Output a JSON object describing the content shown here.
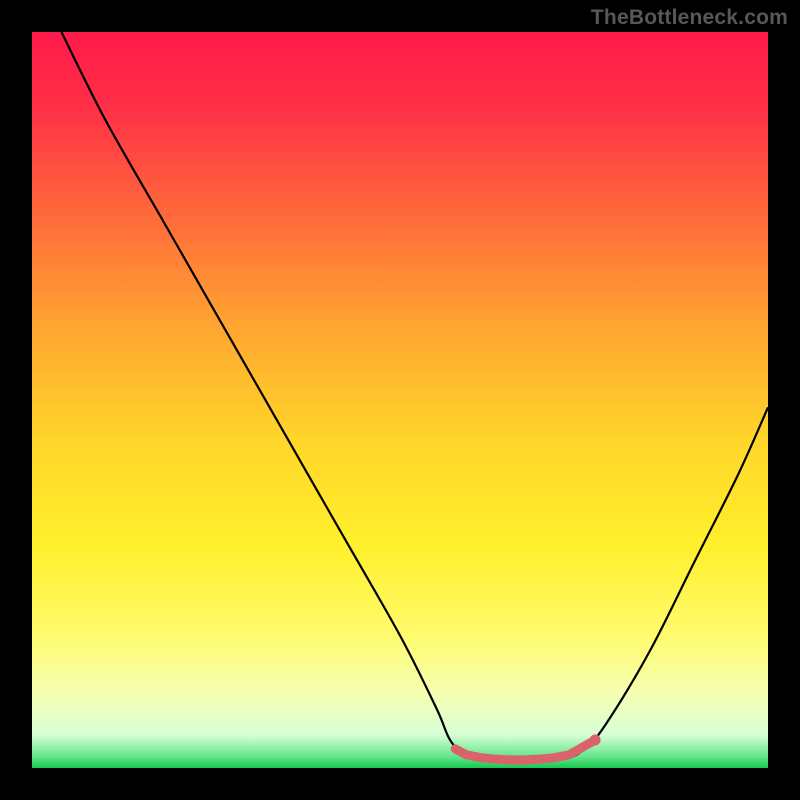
{
  "watermark": "TheBottleneck.com",
  "chart_data": {
    "type": "line",
    "title": "",
    "xlabel": "",
    "ylabel": "",
    "xlim": [
      0,
      100
    ],
    "ylim": [
      0,
      100
    ],
    "gradient_stops": [
      {
        "offset": 0,
        "color": "#ff1a4b"
      },
      {
        "offset": 0.1,
        "color": "#ff2f47"
      },
      {
        "offset": 0.25,
        "color": "#ff6a3a"
      },
      {
        "offset": 0.4,
        "color": "#ffa531"
      },
      {
        "offset": 0.55,
        "color": "#ffd52a"
      },
      {
        "offset": 0.7,
        "color": "#fff02c"
      },
      {
        "offset": 0.82,
        "color": "#fffb6e"
      },
      {
        "offset": 0.9,
        "color": "#f5ffb3"
      },
      {
        "offset": 0.955,
        "color": "#d6ffd6"
      },
      {
        "offset": 0.985,
        "color": "#63e58a"
      },
      {
        "offset": 1.0,
        "color": "#17c84f"
      }
    ],
    "series": [
      {
        "name": "bottleneck-curve",
        "color": "#000000",
        "x": [
          4,
          10,
          18,
          26,
          34,
          42,
          50,
          55,
          57,
          60,
          66,
          72,
          75,
          78,
          84,
          90,
          96,
          100
        ],
        "values": [
          100,
          88,
          74,
          60,
          46,
          32,
          18,
          8,
          3.5,
          1.2,
          1.0,
          1.2,
          2.5,
          6,
          16,
          28,
          40,
          49
        ]
      }
    ],
    "markers": {
      "name": "sweet-spot",
      "color": "#d9626b",
      "points": [
        {
          "x": 57.5,
          "y": 2.6
        },
        {
          "x": 59.0,
          "y": 1.8
        },
        {
          "x": 61.0,
          "y": 1.4
        },
        {
          "x": 63.0,
          "y": 1.2
        },
        {
          "x": 65.0,
          "y": 1.1
        },
        {
          "x": 67.0,
          "y": 1.1
        },
        {
          "x": 69.0,
          "y": 1.2
        },
        {
          "x": 71.0,
          "y": 1.4
        },
        {
          "x": 73.0,
          "y": 1.8
        },
        {
          "x": 76.5,
          "y": 3.8
        }
      ]
    }
  }
}
